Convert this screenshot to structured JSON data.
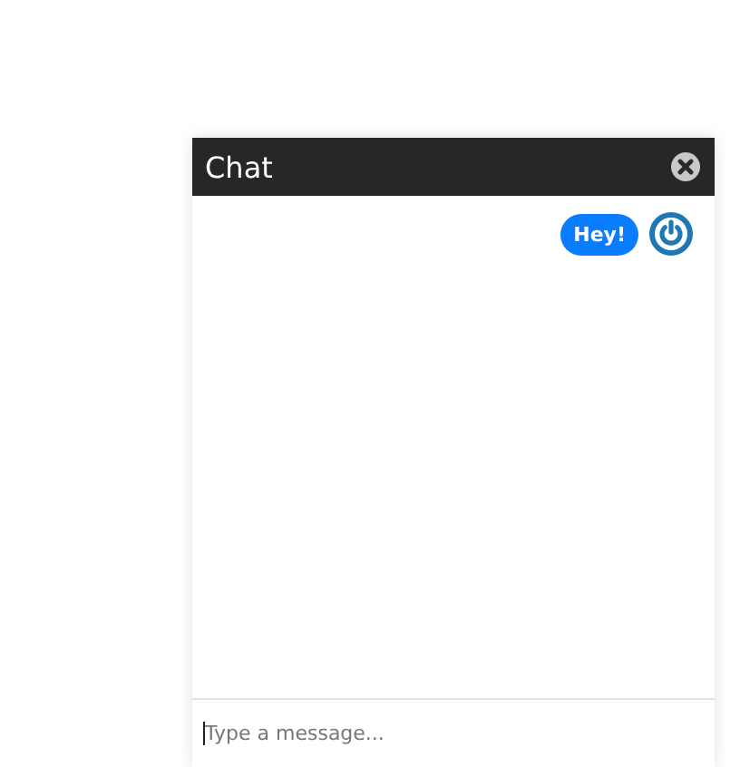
{
  "chat": {
    "title": "Chat",
    "messages": [
      {
        "text": "Hey!",
        "kind": "sent"
      }
    ],
    "input": {
      "placeholder": "Type a message..."
    }
  }
}
